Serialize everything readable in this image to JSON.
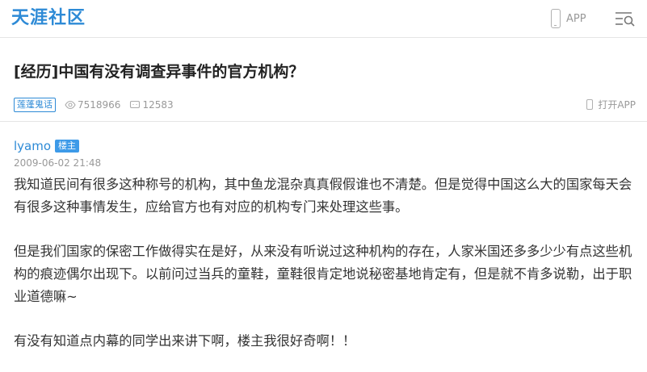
{
  "header": {
    "logo": "天涯社区",
    "app_label": "APP"
  },
  "post": {
    "title": "[经历]中国有没有调查异事件的官方机构？",
    "category": "莲蓬鬼话",
    "views": "7518966",
    "replies": "12583",
    "open_app": "打开APP",
    "author": "lyamo",
    "owner_badge": "楼主",
    "time": "2009-06-02 21:48",
    "paragraphs": [
      "我知道民间有很多这种称号的机构，其中鱼龙混杂真真假假谁也不清楚。但是觉得中国这么大的国家每天会有很多这种事情发生，应给官方也有对应的机构专门来处理这些事。",
      "但是我们国家的保密工作做得实在是好，从来没有听说过这种机构的存在，人家米国还多多少少有点这些机构的痕迹偶尔出现下。以前问过当兵的童鞋，童鞋很肯定地说秘密基地肯定有，但是就不肯多说勒，出于职业道德嘛~",
      "有没有知道点内幕的同学出来讲下啊，楼主我很好奇啊！！"
    ]
  }
}
